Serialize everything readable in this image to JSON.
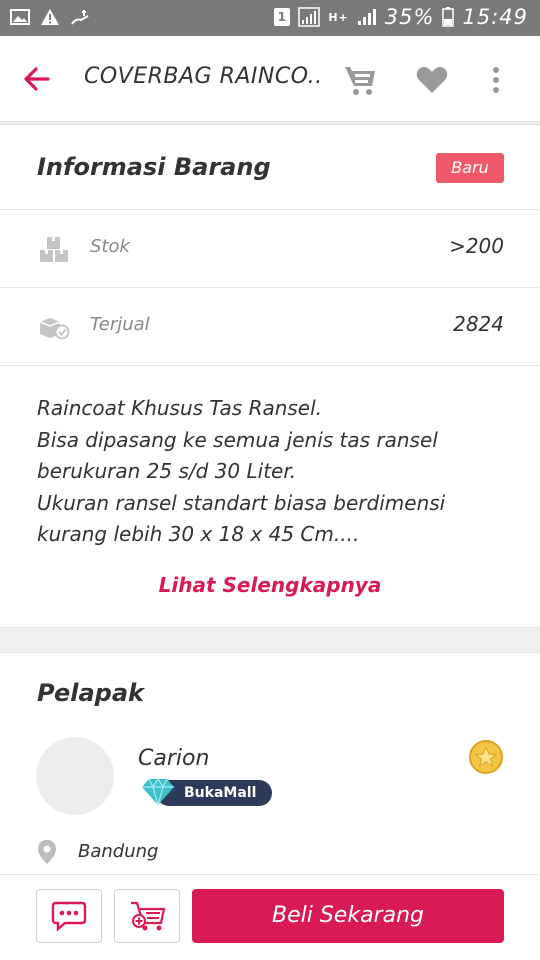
{
  "status_bar": {
    "sim_indicator": "1",
    "network_type": "H+",
    "battery": "35%",
    "time": "15:49"
  },
  "app_bar": {
    "title": "COVERBAG RAINCO...",
    "icons": [
      "arrow-left-icon",
      "cart-icon",
      "heart-icon",
      "more-vert-icon"
    ]
  },
  "product_info": {
    "section_title": "Informasi Barang",
    "condition_badge": "Baru",
    "stock": {
      "label": "Stok",
      "value": ">200"
    },
    "sold": {
      "label": "Terjual",
      "value": "2824"
    },
    "description_lines": [
      "Raincoat Khusus Tas Ransel.",
      "Bisa dipasang ke semua jenis tas ransel",
      "berukuran 25 s/d 30 Liter.",
      "Ukuran ransel standart biasa berdimensi",
      "kurang lebih 30 x 18 x 45 Cm...."
    ],
    "see_more_label": "Lihat Selengkapnya"
  },
  "seller": {
    "section_title": "Pelapak",
    "name": "Carion",
    "badge_label": "BukaMall",
    "location": "Bandung"
  },
  "bottom_bar": {
    "buy_label": "Beli Sekarang"
  },
  "colors": {
    "primary": "#d81b54",
    "new_badge": "#ef5a6a",
    "bukamall_pill": "#2e3a59",
    "status_bar": "#7a7a7a"
  }
}
